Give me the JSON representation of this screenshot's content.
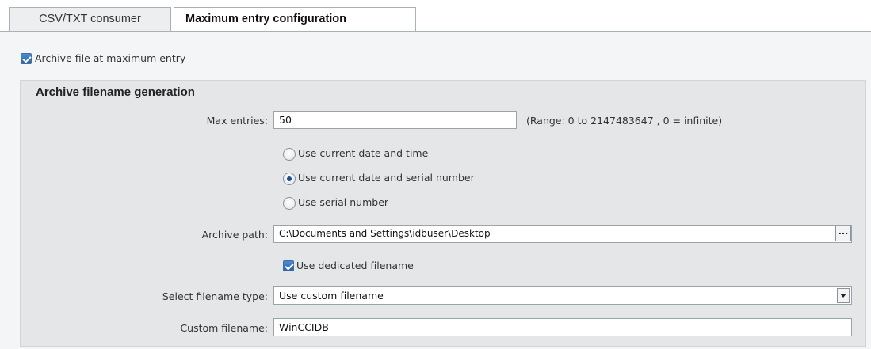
{
  "tabs": [
    {
      "label": "CSV/TXT consumer",
      "active": false
    },
    {
      "label": "Maximum entry configuration",
      "active": true
    }
  ],
  "archive_checkbox": {
    "label": "Archive file at maximum entry",
    "checked": true
  },
  "group": {
    "title": "Archive filename generation",
    "max_entries": {
      "label": "Max entries:",
      "value": "50",
      "hint": "(Range: 0 to 2147483647 , 0 = infinite)"
    },
    "radios": [
      {
        "label": "Use current date and time",
        "selected": false
      },
      {
        "label": "Use current date and serial number",
        "selected": true
      },
      {
        "label": "Use serial number",
        "selected": false
      }
    ],
    "archive_path": {
      "label": "Archive path:",
      "value": "C:\\Documents and Settings\\idbuser\\Desktop",
      "browse_label": "..."
    },
    "dedicated_filename": {
      "label": "Use dedicated filename",
      "checked": true
    },
    "filename_type": {
      "label": "Select filename type:",
      "value": "Use custom filename"
    },
    "custom_filename": {
      "label": "Custom filename:",
      "value": "WinCCIDB"
    }
  },
  "colors": {
    "accent": "#2b62a8",
    "panel": "#e4e6e8",
    "background": "#f4f5f6"
  }
}
